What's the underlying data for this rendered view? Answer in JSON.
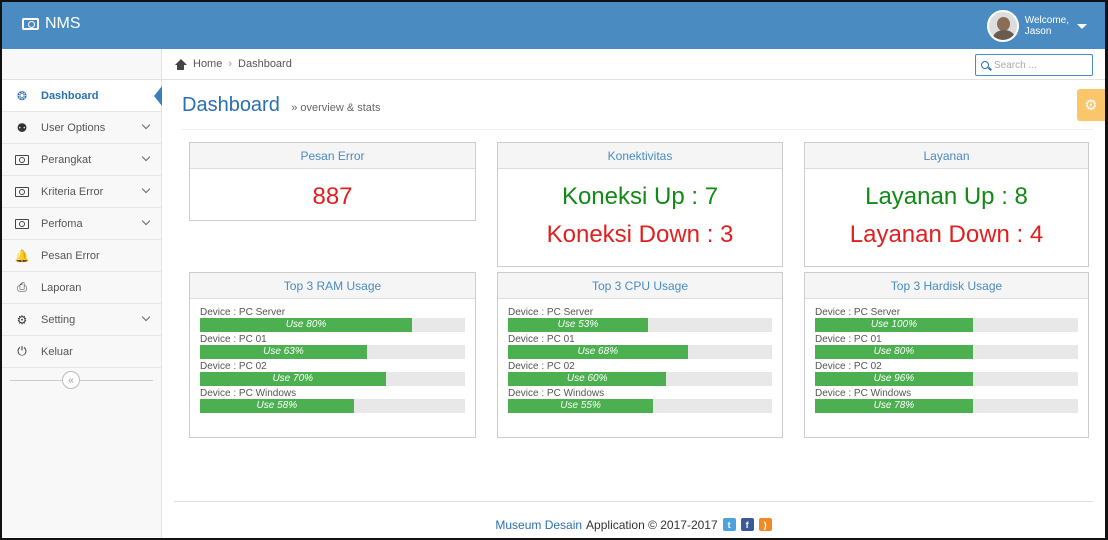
{
  "app": {
    "brand": "NMS"
  },
  "user": {
    "welcome": "Welcome,",
    "name": "Jason"
  },
  "breadcrumb": {
    "home": "Home",
    "separator": "›",
    "current": "Dashboard"
  },
  "search": {
    "placeholder": "Search ..."
  },
  "sidebar": {
    "items": [
      {
        "label": "Dashboard",
        "icon": "dashboard-icon",
        "active": true,
        "has_children": false
      },
      {
        "label": "User Options",
        "icon": "users-icon",
        "active": false,
        "has_children": true
      },
      {
        "label": "Perangkat",
        "icon": "device-icon",
        "active": false,
        "has_children": true
      },
      {
        "label": "Kriteria Error",
        "icon": "device-icon",
        "active": false,
        "has_children": true
      },
      {
        "label": "Perfoma",
        "icon": "device-icon",
        "active": false,
        "has_children": true
      },
      {
        "label": "Pesan Error",
        "icon": "bell-icon",
        "active": false,
        "has_children": false
      },
      {
        "label": "Laporan",
        "icon": "printer-icon",
        "active": false,
        "has_children": false
      },
      {
        "label": "Setting",
        "icon": "gear-icon",
        "active": false,
        "has_children": true
      },
      {
        "label": "Keluar",
        "icon": "power-icon",
        "active": false,
        "has_children": false
      }
    ],
    "collapse_glyph": "«"
  },
  "page": {
    "title": "Dashboard",
    "subtitle": "» overview & stats"
  },
  "stats": {
    "pesan_error": {
      "title": "Pesan Error",
      "value": "887"
    },
    "konektivitas": {
      "title": "Konektivitas",
      "up": "Koneksi Up : 7",
      "down": "Koneksi Down : 3"
    },
    "layanan": {
      "title": "Layanan",
      "up": "Layanan Up : 8",
      "down": "Layanan Down : 4"
    }
  },
  "usage_panels": [
    {
      "title": "Top 3 RAM Usage",
      "rows": [
        {
          "device": "Device : PC Server",
          "label": "Use 80%",
          "percent": 80
        },
        {
          "device": "Device : PC 01",
          "label": "Use 63%",
          "percent": 63
        },
        {
          "device": "Device : PC 02",
          "label": "Use 70%",
          "percent": 70
        },
        {
          "device": "Device : PC Windows",
          "label": "Use 58%",
          "percent": 58
        }
      ]
    },
    {
      "title": "Top 3 CPU Usage",
      "rows": [
        {
          "device": "Device : PC Server",
          "label": "Use 53%",
          "percent": 53
        },
        {
          "device": "Device : PC 01",
          "label": "Use 68%",
          "percent": 68
        },
        {
          "device": "Device : PC 02",
          "label": "Use 60%",
          "percent": 60
        },
        {
          "device": "Device : PC Windows",
          "label": "Use 55%",
          "percent": 55
        }
      ]
    },
    {
      "title": "Top 3 Hardisk Usage",
      "rows": [
        {
          "device": "Device : PC Server",
          "label": "Use 100%",
          "percent": 60
        },
        {
          "device": "Device : PC 01",
          "label": "Use 80%",
          "percent": 60
        },
        {
          "device": "Device : PC 02",
          "label": "Use 96%",
          "percent": 60
        },
        {
          "device": "Device : PC Windows",
          "label": "Use 78%",
          "percent": 60
        }
      ]
    }
  ],
  "footer": {
    "brand": "Museum Desain",
    "text": "Application © 2017-2017",
    "social": [
      "twitter-icon",
      "facebook-icon",
      "rss-icon"
    ]
  },
  "colors": {
    "navbar": "#4a8bc2",
    "bar_fill": "#4caf50",
    "error_red": "#e02020",
    "ok_green": "#138a16",
    "gear_button": "#fbc66b"
  }
}
